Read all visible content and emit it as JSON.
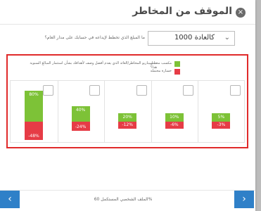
{
  "dialog": {
    "title": "الموقف من المخاطر",
    "close_glyph": "×"
  },
  "question1": "ما المبلغ الذي تخطط لإيداعه في حسابك على مدار العام؟",
  "amount_select": {
    "value": "كالعادة 1000",
    "chevron": "⌄"
  },
  "question2": "ما سيناريو المخاطر/العائد الذي يقدم أفضل وصف لأهدافك بشأن استثمار المبالغ السنوية هذا؟",
  "legend": {
    "gain_label": "مكسب محتمل",
    "loss_label": "خسارة محتملة",
    "gain_color": "#7dc237",
    "loss_color": "#e63c46"
  },
  "scenarios": [
    {
      "gain": "80%",
      "loss": "-48%",
      "gain_value": 80,
      "loss_value": -48
    },
    {
      "gain": "40%",
      "loss": "-24%",
      "gain_value": 40,
      "loss_value": -24
    },
    {
      "gain": "20%",
      "loss": "-12%",
      "gain_value": 20,
      "loss_value": -12
    },
    {
      "gain": "10%",
      "loss": "-6%",
      "gain_value": 10,
      "loss_value": -6
    },
    {
      "gain": "5%",
      "loss": "-3%",
      "gain_value": 5,
      "loss_value": -3
    }
  ],
  "footer": {
    "progress_text": "الملف الشخصي المستكمل 60%",
    "prev_glyph": "‹",
    "next_glyph": "›"
  }
}
